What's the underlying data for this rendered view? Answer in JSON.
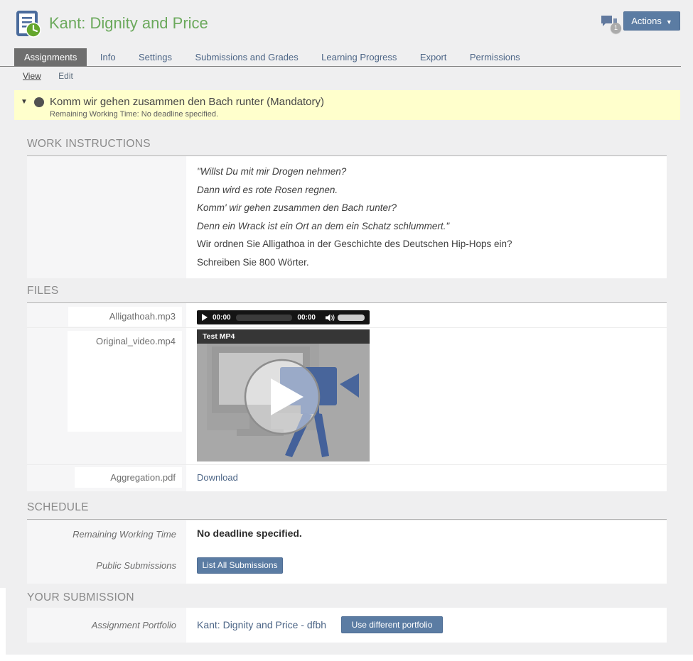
{
  "header": {
    "title": "Kant: Dignity and Price",
    "comments_badge": "1",
    "actions_label": "Actions",
    "icons": {
      "object": "exercise-icon",
      "comments": "speech-bubbles-icon",
      "actions_caret": "chevron-down-icon"
    }
  },
  "tabs": {
    "items": [
      {
        "label": "Assignments",
        "active": true
      },
      {
        "label": "Info",
        "active": false
      },
      {
        "label": "Settings",
        "active": false
      },
      {
        "label": "Submissions and Grades",
        "active": false
      },
      {
        "label": "Learning Progress",
        "active": false
      },
      {
        "label": "Export",
        "active": false
      },
      {
        "label": "Permissions",
        "active": false
      }
    ],
    "subtabs": [
      {
        "label": "View",
        "active": true
      },
      {
        "label": "Edit",
        "active": false
      }
    ]
  },
  "banner": {
    "title": "Komm wir gehen zusammen den Bach runter (Mandatory)",
    "subtitle": "Remaining Working Time: No deadline specified.",
    "collapse_icon": "triangle-down-icon",
    "status_icon": "status-circle-icon"
  },
  "work_instructions": {
    "title": "WORK INSTRUCTIONS",
    "paragraphs": [
      "\"Willst Du mit mir Drogen nehmen?",
      "Dann wird es rote Rosen regnen.",
      "Komm' wir gehen zusammen den Bach runter?",
      "Denn ein Wrack ist ein Ort an dem ein Schatz schlummert.\"",
      "Wir ordnen Sie Alligathoa in der Geschichte des Deutschen Hip-Hops ein?",
      "Schreiben Sie 800 Wörter."
    ]
  },
  "files": {
    "title": "FILES",
    "rows": [
      {
        "label": "Alligathoah.mp3",
        "type": "audio"
      },
      {
        "label": "Original_video.mp4",
        "type": "video"
      },
      {
        "label": "Aggregation.pdf",
        "type": "download"
      }
    ],
    "audio": {
      "current_time": "00:00",
      "duration": "00:00"
    },
    "video": {
      "overlay_title": "Test MP4"
    },
    "download_label": "Download"
  },
  "schedule": {
    "title": "SCHEDULE",
    "rows": [
      {
        "label": "Remaining Working Time",
        "value": "No deadline specified."
      },
      {
        "label": "Public Submissions",
        "button": "List All Submissions"
      }
    ]
  },
  "your_submission": {
    "title": "YOUR SUBMISSION",
    "label": "Assignment Portfolio",
    "portfolio_link": "Kant: Dignity and Price - dfbh",
    "button": "Use different portfolio"
  },
  "colors": {
    "title_green": "#6ba95c",
    "link_blue": "#4c6586",
    "button_blue": "#5b7ca3",
    "banner_yellow": "#ffffcc",
    "active_tab_gray": "#6e6e6e",
    "background_gray": "#efeff0"
  }
}
